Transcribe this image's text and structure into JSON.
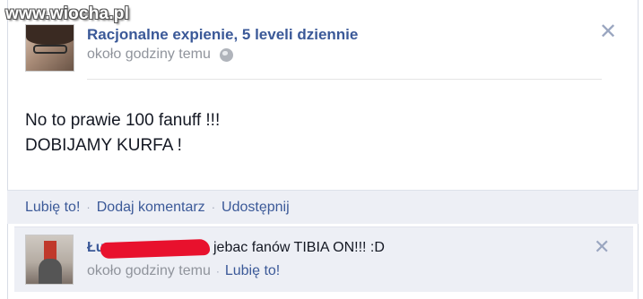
{
  "watermark": "www.wiocha.pl",
  "post": {
    "author": "Racjonalne expienie, 5 leveli dziennie",
    "time": "około godziny temu",
    "text_line1": "No to prawie 100 fanuff !!!",
    "text_line2": "DOBIJAMY KURFA !",
    "close_symbol": "✕",
    "privacy_icon": "globe-icon"
  },
  "actions": {
    "like": "Lubię to!",
    "comment": "Dodaj komentarz",
    "share": "Udostępnij",
    "separator": "·"
  },
  "comment": {
    "author_visible": "Łu",
    "text": "jebac fanów TIBIA ON!!! :D",
    "time": "około godziny temu",
    "like": "Lubię to!",
    "separator": "·",
    "close_symbol": "✕"
  },
  "colors": {
    "link_blue": "#3b5998",
    "muted_gray": "#90949c",
    "action_bg": "#edeff5",
    "redaction_red": "#e8112d"
  }
}
